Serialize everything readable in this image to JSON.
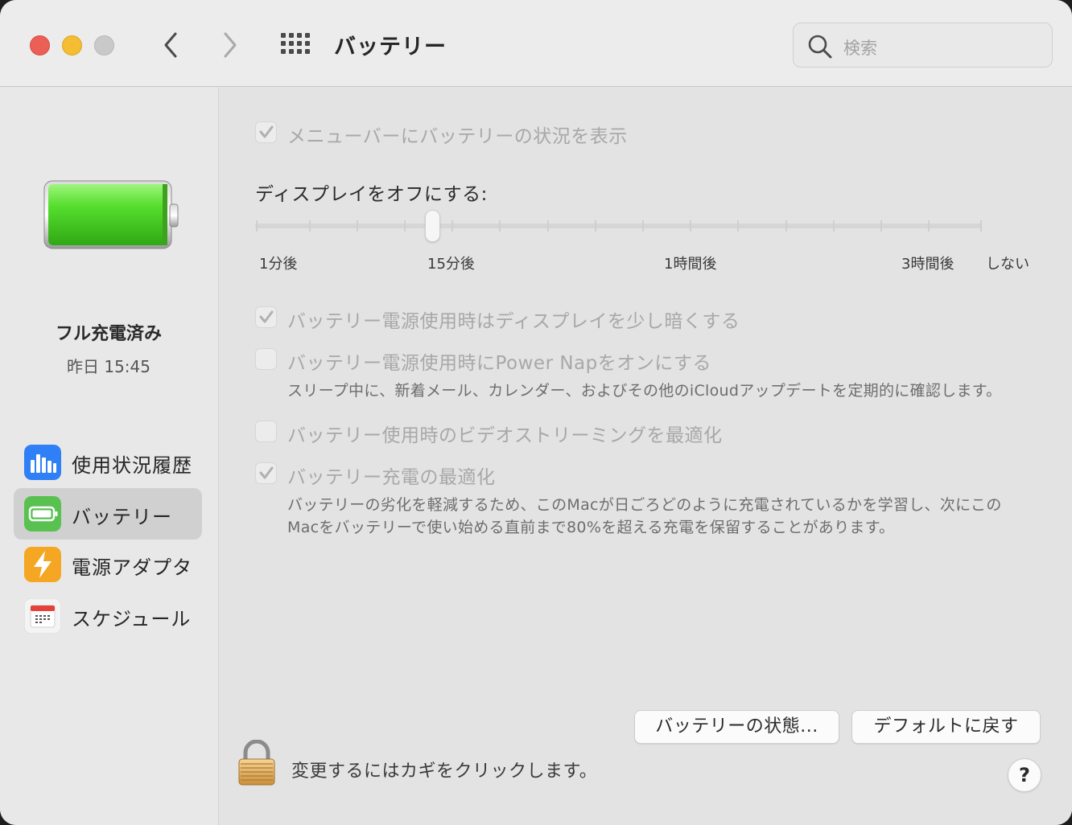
{
  "window": {
    "title": "バッテリー"
  },
  "search": {
    "placeholder": "検索"
  },
  "sidebar": {
    "status_title": "フル充電済み",
    "status_time": "昨日 15:45",
    "items": [
      {
        "label": "使用状況履歴",
        "icon": "bar-chart-icon"
      },
      {
        "label": "バッテリー",
        "icon": "battery-icon",
        "selected": true
      },
      {
        "label": "電源アダプタ",
        "icon": "lightning-icon"
      },
      {
        "label": "スケジュール",
        "icon": "calendar-icon"
      }
    ]
  },
  "settings": {
    "show_in_menubar": {
      "label": "メニューバーにバッテリーの状況を表示",
      "checked": true
    },
    "display_off": {
      "title": "ディスプレイをオフにする:",
      "tick_labels": [
        "1分後",
        "15分後",
        "1時間後",
        "3時間後",
        "しない"
      ],
      "value": "15分後"
    },
    "dim_display": {
      "label": "バッテリー電源使用時はディスプレイを少し暗くする",
      "checked": true
    },
    "power_nap": {
      "label": "バッテリー電源使用時にPower Napをオンにする",
      "checked": false,
      "description": "スリープ中に、新着メール、カレンダー、およびその他のiCloudアップデートを定期的に確認します。"
    },
    "video_streaming": {
      "label": "バッテリー使用時のビデオストリーミングを最適化",
      "checked": false
    },
    "optimized_charging": {
      "label": "バッテリー充電の最適化",
      "checked": true,
      "description_line1": "バッテリーの劣化を軽減するため、このMacが日ごろどのように充電されているかを学習し、次にこの",
      "description_line2": "Macをバッテリーで使い始める直前まで80%を超える充電を保留することがあります。"
    }
  },
  "buttons": {
    "battery_health": "バッテリーの状態...",
    "restore_defaults": "デフォルトに戻す",
    "help": "?"
  },
  "lock": {
    "text": "変更するにはカギをクリックします。"
  },
  "colors": {
    "accent_green": "#4cd13f",
    "close": "#ec5f57",
    "minimize": "#f5bd31"
  }
}
